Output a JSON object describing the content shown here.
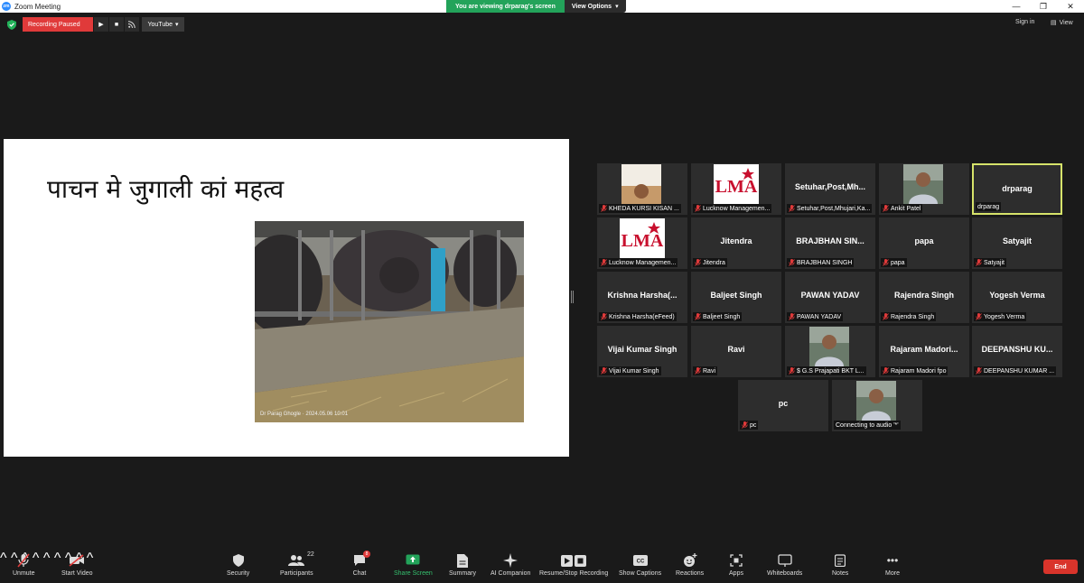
{
  "window": {
    "title": "Zoom Meeting"
  },
  "share_banner": {
    "message": "You are viewing drparag's screen",
    "options_label": "View Options"
  },
  "top_bar": {
    "recording_status": "Recording Paused",
    "youtube_label": "YouTube",
    "sign_in": "Sign in",
    "view": "View"
  },
  "slide": {
    "title": "पाचन मे जुगाली कां महत्व",
    "photo_credit": "Dr Parag Ghogle · 2024.05.06 10:01"
  },
  "participants": [
    {
      "name": "",
      "label": "KHEDA KURSI KISAN ...",
      "thumb": "photo-blank"
    },
    {
      "name": "",
      "label": "Lucknow Managemen...",
      "thumb": "lma-logo"
    },
    {
      "name": "Setuhar,Post,Mh...",
      "label": "Setuhar,Post,Mhujari,Ka..."
    },
    {
      "name": "",
      "label": "Ankit Patel",
      "thumb": "photo-person"
    },
    {
      "name": "drparag",
      "label": "drparag",
      "active": true
    },
    {
      "name": "",
      "label": "Lucknow Managemen...",
      "thumb": "lma-logo"
    },
    {
      "name": "Jitendra",
      "label": "Jitendra"
    },
    {
      "name": "BRAJBHAN SIN...",
      "label": "BRAJBHAN SINGH"
    },
    {
      "name": "papa",
      "label": "papa"
    },
    {
      "name": "Satyajit",
      "label": "Satyajit"
    },
    {
      "name": "Krishna  Harsha(...",
      "label": "Krishna Harsha(eFeed)"
    },
    {
      "name": "Baljeet Singh",
      "label": "Baljeet Singh"
    },
    {
      "name": "PAWAN YADAV",
      "label": "PAWAN YADAV"
    },
    {
      "name": "Rajendra Singh",
      "label": "Rajendra Singh"
    },
    {
      "name": "Yogesh Verma",
      "label": "Yogesh Verma"
    },
    {
      "name": "Vijai Kumar Singh",
      "label": "Vijai Kumar Singh"
    },
    {
      "name": "Ravi",
      "label": "Ravi"
    },
    {
      "name": "",
      "label": "$ G.S Prajapati BKT L...",
      "thumb": "photo-person"
    },
    {
      "name": "Rajaram  Madori...",
      "label": "Rajaram Madori fpo"
    },
    {
      "name": "DEEPANSHU  KU...",
      "label": "DEEPANSHU KUMAR ..."
    },
    {
      "name": "pc",
      "label": "pc"
    },
    {
      "name": "",
      "label": "Connecting to audio '*'",
      "thumb": "photo-person",
      "no_mic": true
    }
  ],
  "toolbar": {
    "unmute": "Unmute",
    "start_video": "Start Video",
    "security": "Security",
    "participants": "Participants",
    "participants_count": "22",
    "chat": "Chat",
    "chat_badge": "8",
    "share_screen": "Share Screen",
    "summary": "Summary",
    "ai_companion": "AI Companion",
    "recording": "Resume/Stop Recording",
    "captions": "Show Captions",
    "reactions": "Reactions",
    "apps": "Apps",
    "whiteboards": "Whiteboards",
    "notes": "Notes",
    "more": "More",
    "end": "End"
  },
  "colors": {
    "background": "#1a1a1a",
    "tile": "#2d2d2d",
    "active_border": "#d6e36a",
    "recording_red": "#e03a3a",
    "share_green": "#23a35a",
    "end_red": "#d9342b"
  }
}
